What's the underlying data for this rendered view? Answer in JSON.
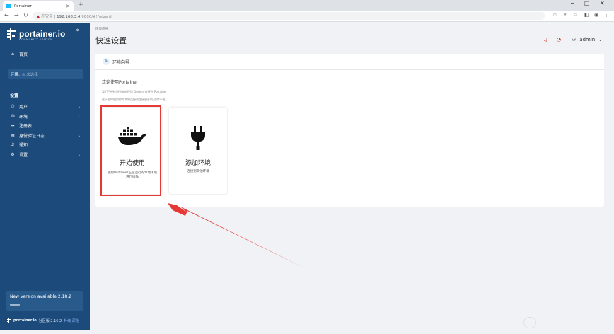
{
  "browser": {
    "tab_title": "Portainer",
    "tab_close": "✕",
    "new_tab": "+",
    "url_warning": "不安全",
    "url_host": "192.168.3.4",
    "url_rest": ":9000/#!/wizard"
  },
  "sidebar": {
    "logo_text": "portainer.io",
    "logo_sub": "COMMUNITY EDITION",
    "home_label": "首页",
    "env_label": "环境:",
    "env_placeholder": "未选择",
    "settings_section": "设置",
    "items": [
      {
        "label": "用户",
        "icon": "users-icon"
      },
      {
        "label": "环境",
        "icon": "environments-icon"
      },
      {
        "label": "注册表",
        "icon": "registry-icon"
      },
      {
        "label": "身份验证日志",
        "icon": "logs-icon"
      },
      {
        "label": "通知",
        "icon": "bell-icon"
      },
      {
        "label": "设置",
        "icon": "gear-icon"
      }
    ],
    "update_text": "New version available 2.18.2",
    "footer_brand": "portainer.io",
    "footer_version": "社区版 2.16.2",
    "footer_link": "升级 深化"
  },
  "header": {
    "breadcrumb": "环境向导",
    "title": "快速设置",
    "username": "admin"
  },
  "wizard": {
    "panel_title": "环境向导",
    "welcome": "欢迎使用Portainer",
    "desc1": "我们已经检测到本地环境 Docker 连接到 Portainer",
    "desc2": "在下面你使用你的本地连接或连接更多的 边缘环境。",
    "cards": [
      {
        "title": "开始使用",
        "desc": "使用Portainer正在运行的本地环境进行操作",
        "icon": "docker-whale-icon"
      },
      {
        "title": "添加环境",
        "desc": "连接到其他环境",
        "icon": "plug-icon"
      }
    ]
  },
  "colors": {
    "sidebar": "#1c4a7a",
    "highlight": "#e53935",
    "arrow": "#e53935"
  }
}
